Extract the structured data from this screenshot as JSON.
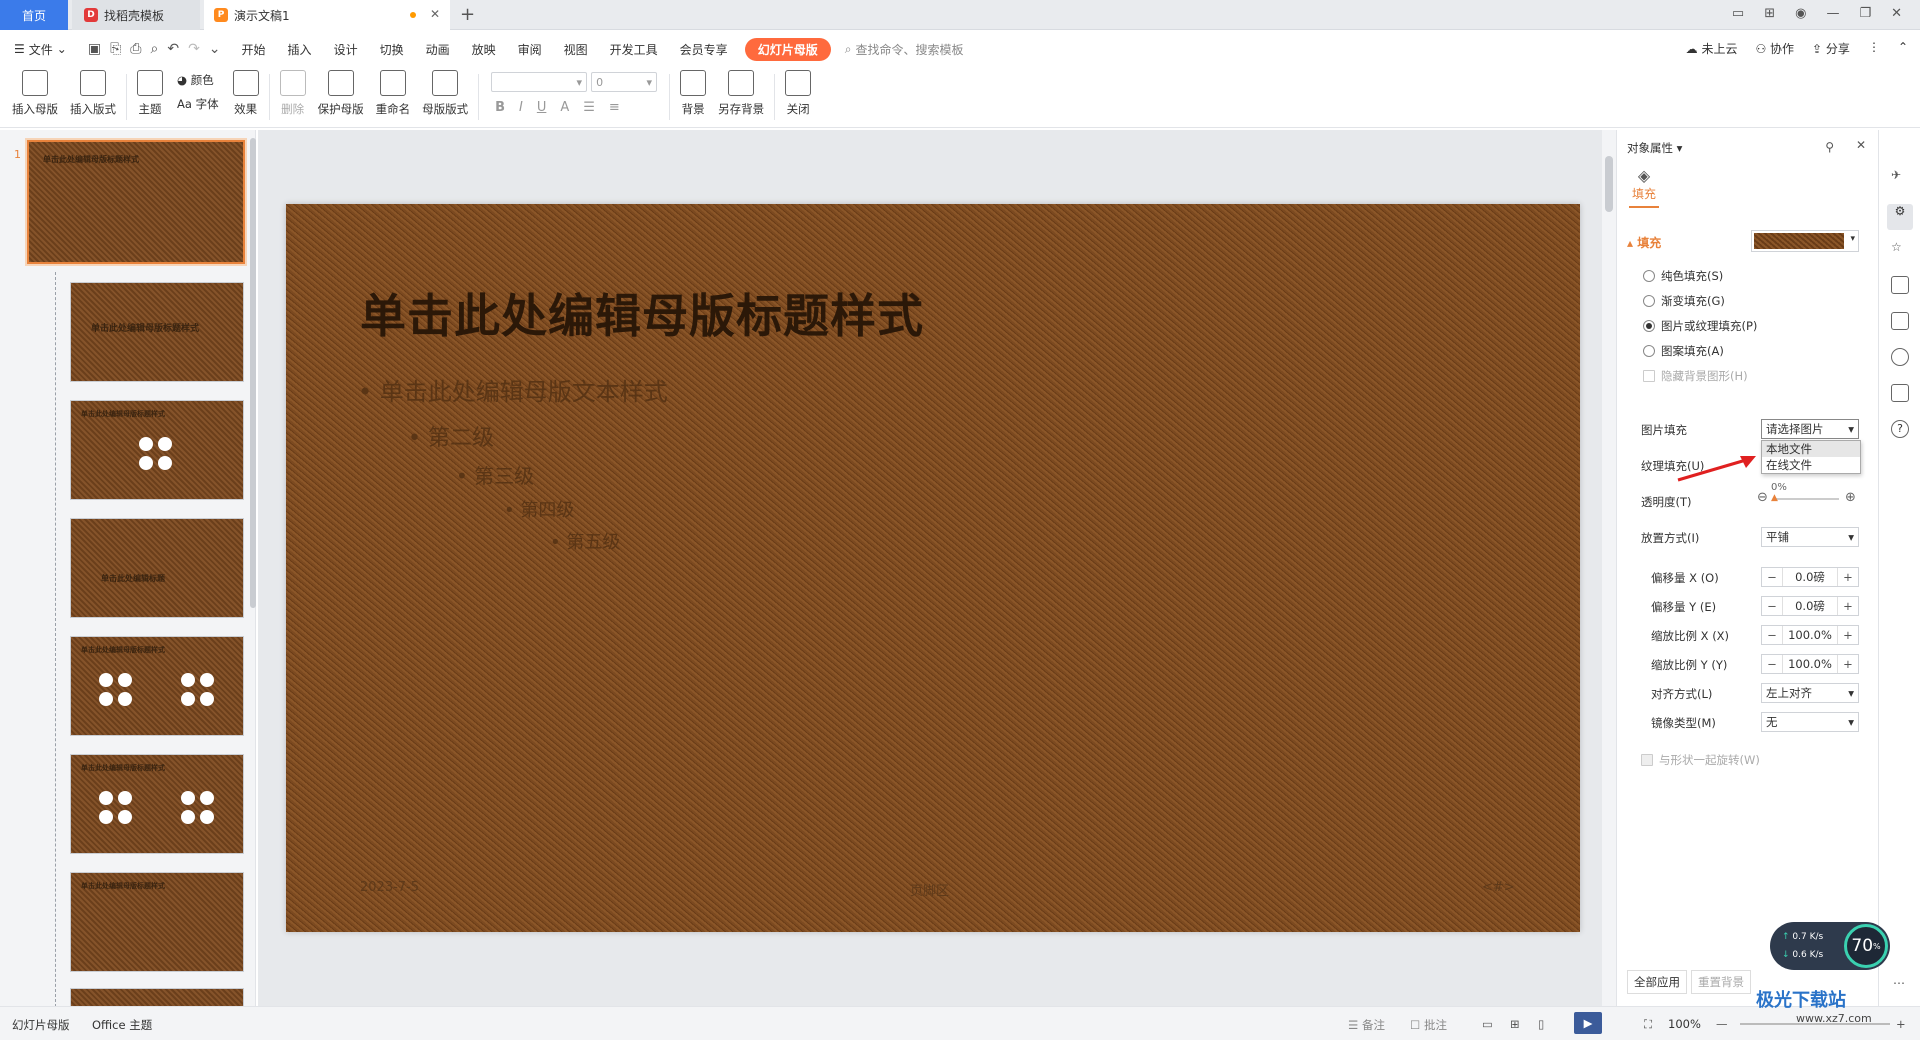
{
  "tabs": {
    "home": "首页",
    "template": "找稻壳模板",
    "document": "演示文稿1"
  },
  "menu": {
    "file": "文件",
    "items": [
      "开始",
      "插入",
      "设计",
      "切换",
      "动画",
      "放映",
      "审阅",
      "视图",
      "开发工具",
      "会员专享"
    ],
    "master_tab": "幻灯片母版",
    "search": "查找命令、搜索模板",
    "right": {
      "cloud": "未上云",
      "collab": "协作",
      "share": "分享"
    }
  },
  "ribbon": {
    "insert_master": "插入母版",
    "insert_layout": "插入版式",
    "theme": "主题",
    "colors": "颜色",
    "font": "Aa 字体",
    "effects": "效果",
    "delete": "删除",
    "protect": "保护母版",
    "rename": "重命名",
    "layout": "母版版式",
    "font_size": "0",
    "background": "背景",
    "save_bg": "另存背景",
    "close": "关闭"
  },
  "thumbnails": {
    "slide_number": "1",
    "title": "单击此处编辑母版标题样式",
    "layout4_title": "单击此处编辑标题"
  },
  "slide": {
    "title": "单击此处编辑母版标题样式",
    "levels": [
      "单击此处编辑母版文本样式",
      "第二级",
      "第三级",
      "第四级",
      "第五级"
    ],
    "date": "2023-7-5",
    "footer": "页脚区",
    "page": "<#>"
  },
  "panel": {
    "header": "对象属性",
    "tab": "填充",
    "section": "填充",
    "options": {
      "solid": "纯色填充(S)",
      "gradient": "渐变填充(G)",
      "picture": "图片或纹理填充(P)",
      "pattern": "图案填充(A)",
      "hide": "隐藏背景图形(H)"
    },
    "picture_fill": {
      "label": "图片填充",
      "value": "请选择图片",
      "menu": [
        "本地文件",
        "在线文件"
      ]
    },
    "texture_fill": "纹理填充(U)",
    "transparency": {
      "label": "透明度(T)",
      "value": "0%"
    },
    "placement": {
      "label": "放置方式(I)",
      "value": "平铺"
    },
    "offset_x": {
      "label": "偏移量 X (O)",
      "value": "0.0磅"
    },
    "offset_y": {
      "label": "偏移量 Y (E)",
      "value": "0.0磅"
    },
    "scale_x": {
      "label": "缩放比例 X (X)",
      "value": "100.0%"
    },
    "scale_y": {
      "label": "缩放比例 Y (Y)",
      "value": "100.0%"
    },
    "align": {
      "label": "对齐方式(L)",
      "value": "左上对齐"
    },
    "mirror": {
      "label": "镜像类型(M)",
      "value": "无"
    },
    "rotate_with": "与形状一起旋转(W)",
    "apply_all": "全部应用",
    "reset": "重置背景"
  },
  "status": {
    "view": "幻灯片母版",
    "theme": "Office 主题",
    "notes": "备注",
    "comments": "批注",
    "zoom": "100%"
  },
  "widget": {
    "up": "0.7",
    "down": "0.6",
    "unit": "K/s",
    "percent": "70"
  },
  "watermark": {
    "name": "极光下载站",
    "url": "www.xz7.com"
  },
  "colors": {
    "accent": "#e8823b",
    "master": "#ff6a3d",
    "home": "#3b7bea"
  }
}
